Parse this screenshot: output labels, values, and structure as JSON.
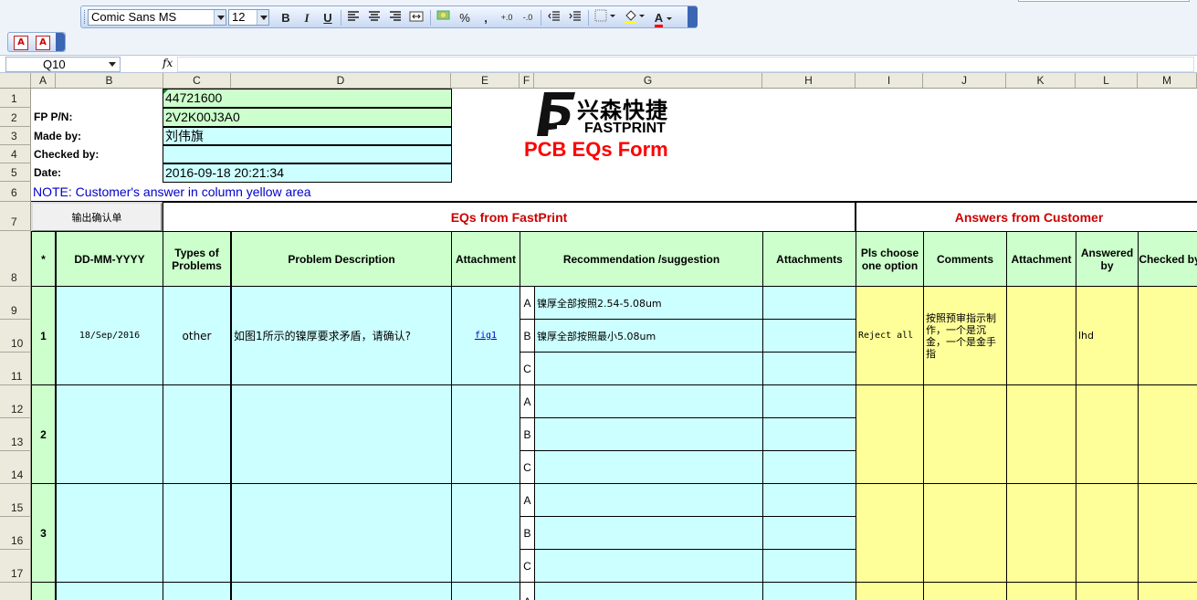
{
  "toolbar": {
    "font_name": "Comic Sans MS",
    "font_size": "12",
    "bold": "B",
    "italic": "I",
    "underline": "U",
    "percent": "%",
    "comma": ",",
    "inc_decimal": "+.0",
    "dec_decimal": "-.0",
    "font_color_letter": "A"
  },
  "formula_bar": {
    "name_box": "Q10",
    "fx": "fx"
  },
  "columns": [
    "A",
    "B",
    "C",
    "D",
    "E",
    "F",
    "G",
    "H",
    "I",
    "J",
    "K",
    "L",
    "M"
  ],
  "rows": [
    "1",
    "2",
    "3",
    "4",
    "5",
    "6",
    "7",
    "8",
    "9",
    "10",
    "11",
    "12",
    "13",
    "14",
    "15",
    "16",
    "17"
  ],
  "form": {
    "order_no": "44721600",
    "fp_pn_label": "FP P/N:",
    "fp_pn": "2V2K00J3A0",
    "made_by_label": "Made by:",
    "made_by": "刘伟旗",
    "checked_by_label": "Checked by:",
    "checked_by": "",
    "date_label": "Date:",
    "date": "2016-09-18 20:21:34",
    "note": "NOTE: Customer's  answer in column yellow area",
    "export_button": "输出确认单",
    "eqs_section": "EQs from FastPrint",
    "answers_section": "Answers from Customer",
    "logo_cn": "兴森快捷",
    "logo_en": "FASTPRINT",
    "title": "PCB EQs Form"
  },
  "headers": {
    "no": "*",
    "date": "DD-MM-YYYY",
    "types": "Types of Problems",
    "problem": "Problem Description",
    "attachment": "Attachment",
    "recommendation": "Recommendation /suggestion",
    "attachments": "Attachments",
    "choose": "Pls choose one option",
    "comments": "Comments",
    "cust_attachment": "Attachment",
    "answered_by": "Answered by",
    "checked_by": "Checked by"
  },
  "eqs": [
    {
      "no": "1",
      "date": "18/Sep/2016",
      "type": "other",
      "problem": "如图1所示的镍厚要求矛盾，请确认?",
      "attachment": "fig1",
      "options": [
        {
          "letter": "A",
          "text": "镍厚全部按照2.54-5.08um"
        },
        {
          "letter": "B",
          "text": "镍厚全部按照最小5.08um"
        },
        {
          "letter": "C",
          "text": ""
        }
      ],
      "choice": "Reject all",
      "comment": "按照预审指示制作，一个是沉金，一个是金手指",
      "answered_by": "lhd"
    },
    {
      "no": "2",
      "options": [
        {
          "letter": "A",
          "text": ""
        },
        {
          "letter": "B",
          "text": ""
        },
        {
          "letter": "C",
          "text": ""
        }
      ]
    },
    {
      "no": "3",
      "options": [
        {
          "letter": "A",
          "text": ""
        },
        {
          "letter": "B",
          "text": ""
        },
        {
          "letter": "C",
          "text": ""
        }
      ]
    },
    {
      "options": [
        {
          "letter": "A",
          "text": ""
        }
      ]
    }
  ],
  "colors": {
    "green": "#ccffcc",
    "cyan": "#ccffff",
    "yellow": "#ffff99",
    "title_red": "#ff0000",
    "section_red": "#cc0000",
    "note_blue": "#0000cc"
  }
}
